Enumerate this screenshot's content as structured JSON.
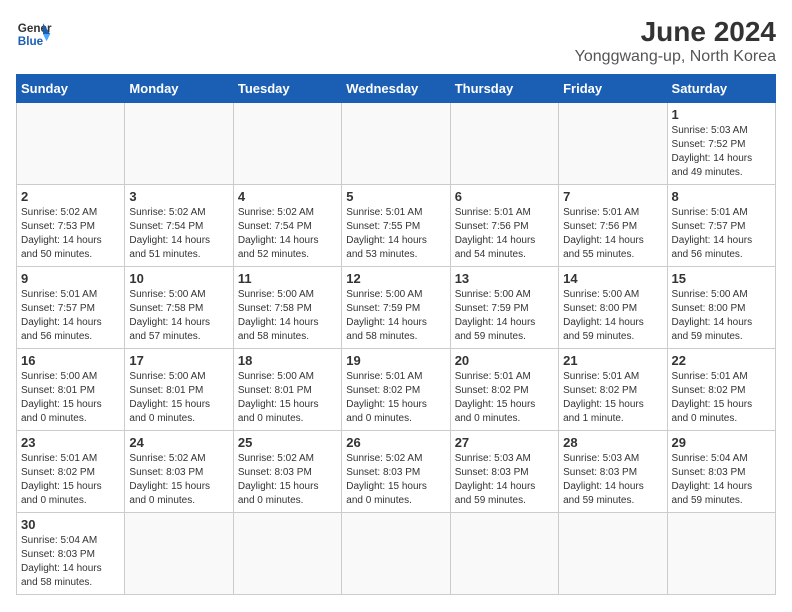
{
  "logo": {
    "line1": "General",
    "line2": "Blue"
  },
  "title": "June 2024",
  "subtitle": "Yonggwang-up, North Korea",
  "days_of_week": [
    "Sunday",
    "Monday",
    "Tuesday",
    "Wednesday",
    "Thursday",
    "Friday",
    "Saturday"
  ],
  "weeks": [
    [
      {
        "day": "",
        "info": ""
      },
      {
        "day": "",
        "info": ""
      },
      {
        "day": "",
        "info": ""
      },
      {
        "day": "",
        "info": ""
      },
      {
        "day": "",
        "info": ""
      },
      {
        "day": "",
        "info": ""
      },
      {
        "day": "1",
        "info": "Sunrise: 5:03 AM\nSunset: 7:52 PM\nDaylight: 14 hours\nand 49 minutes."
      }
    ],
    [
      {
        "day": "2",
        "info": "Sunrise: 5:02 AM\nSunset: 7:53 PM\nDaylight: 14 hours\nand 50 minutes."
      },
      {
        "day": "3",
        "info": "Sunrise: 5:02 AM\nSunset: 7:54 PM\nDaylight: 14 hours\nand 51 minutes."
      },
      {
        "day": "4",
        "info": "Sunrise: 5:02 AM\nSunset: 7:54 PM\nDaylight: 14 hours\nand 52 minutes."
      },
      {
        "day": "5",
        "info": "Sunrise: 5:01 AM\nSunset: 7:55 PM\nDaylight: 14 hours\nand 53 minutes."
      },
      {
        "day": "6",
        "info": "Sunrise: 5:01 AM\nSunset: 7:56 PM\nDaylight: 14 hours\nand 54 minutes."
      },
      {
        "day": "7",
        "info": "Sunrise: 5:01 AM\nSunset: 7:56 PM\nDaylight: 14 hours\nand 55 minutes."
      },
      {
        "day": "8",
        "info": "Sunrise: 5:01 AM\nSunset: 7:57 PM\nDaylight: 14 hours\nand 56 minutes."
      }
    ],
    [
      {
        "day": "9",
        "info": "Sunrise: 5:01 AM\nSunset: 7:57 PM\nDaylight: 14 hours\nand 56 minutes."
      },
      {
        "day": "10",
        "info": "Sunrise: 5:00 AM\nSunset: 7:58 PM\nDaylight: 14 hours\nand 57 minutes."
      },
      {
        "day": "11",
        "info": "Sunrise: 5:00 AM\nSunset: 7:58 PM\nDaylight: 14 hours\nand 58 minutes."
      },
      {
        "day": "12",
        "info": "Sunrise: 5:00 AM\nSunset: 7:59 PM\nDaylight: 14 hours\nand 58 minutes."
      },
      {
        "day": "13",
        "info": "Sunrise: 5:00 AM\nSunset: 7:59 PM\nDaylight: 14 hours\nand 59 minutes."
      },
      {
        "day": "14",
        "info": "Sunrise: 5:00 AM\nSunset: 8:00 PM\nDaylight: 14 hours\nand 59 minutes."
      },
      {
        "day": "15",
        "info": "Sunrise: 5:00 AM\nSunset: 8:00 PM\nDaylight: 14 hours\nand 59 minutes."
      }
    ],
    [
      {
        "day": "16",
        "info": "Sunrise: 5:00 AM\nSunset: 8:01 PM\nDaylight: 15 hours\nand 0 minutes."
      },
      {
        "day": "17",
        "info": "Sunrise: 5:00 AM\nSunset: 8:01 PM\nDaylight: 15 hours\nand 0 minutes."
      },
      {
        "day": "18",
        "info": "Sunrise: 5:00 AM\nSunset: 8:01 PM\nDaylight: 15 hours\nand 0 minutes."
      },
      {
        "day": "19",
        "info": "Sunrise: 5:01 AM\nSunset: 8:02 PM\nDaylight: 15 hours\nand 0 minutes."
      },
      {
        "day": "20",
        "info": "Sunrise: 5:01 AM\nSunset: 8:02 PM\nDaylight: 15 hours\nand 0 minutes."
      },
      {
        "day": "21",
        "info": "Sunrise: 5:01 AM\nSunset: 8:02 PM\nDaylight: 15 hours\nand 1 minute."
      },
      {
        "day": "22",
        "info": "Sunrise: 5:01 AM\nSunset: 8:02 PM\nDaylight: 15 hours\nand 0 minutes."
      }
    ],
    [
      {
        "day": "23",
        "info": "Sunrise: 5:01 AM\nSunset: 8:02 PM\nDaylight: 15 hours\nand 0 minutes."
      },
      {
        "day": "24",
        "info": "Sunrise: 5:02 AM\nSunset: 8:03 PM\nDaylight: 15 hours\nand 0 minutes."
      },
      {
        "day": "25",
        "info": "Sunrise: 5:02 AM\nSunset: 8:03 PM\nDaylight: 15 hours\nand 0 minutes."
      },
      {
        "day": "26",
        "info": "Sunrise: 5:02 AM\nSunset: 8:03 PM\nDaylight: 15 hours\nand 0 minutes."
      },
      {
        "day": "27",
        "info": "Sunrise: 5:03 AM\nSunset: 8:03 PM\nDaylight: 14 hours\nand 59 minutes."
      },
      {
        "day": "28",
        "info": "Sunrise: 5:03 AM\nSunset: 8:03 PM\nDaylight: 14 hours\nand 59 minutes."
      },
      {
        "day": "29",
        "info": "Sunrise: 5:04 AM\nSunset: 8:03 PM\nDaylight: 14 hours\nand 59 minutes."
      }
    ],
    [
      {
        "day": "30",
        "info": "Sunrise: 5:04 AM\nSunset: 8:03 PM\nDaylight: 14 hours\nand 58 minutes."
      },
      {
        "day": "",
        "info": ""
      },
      {
        "day": "",
        "info": ""
      },
      {
        "day": "",
        "info": ""
      },
      {
        "day": "",
        "info": ""
      },
      {
        "day": "",
        "info": ""
      },
      {
        "day": "",
        "info": ""
      }
    ]
  ]
}
